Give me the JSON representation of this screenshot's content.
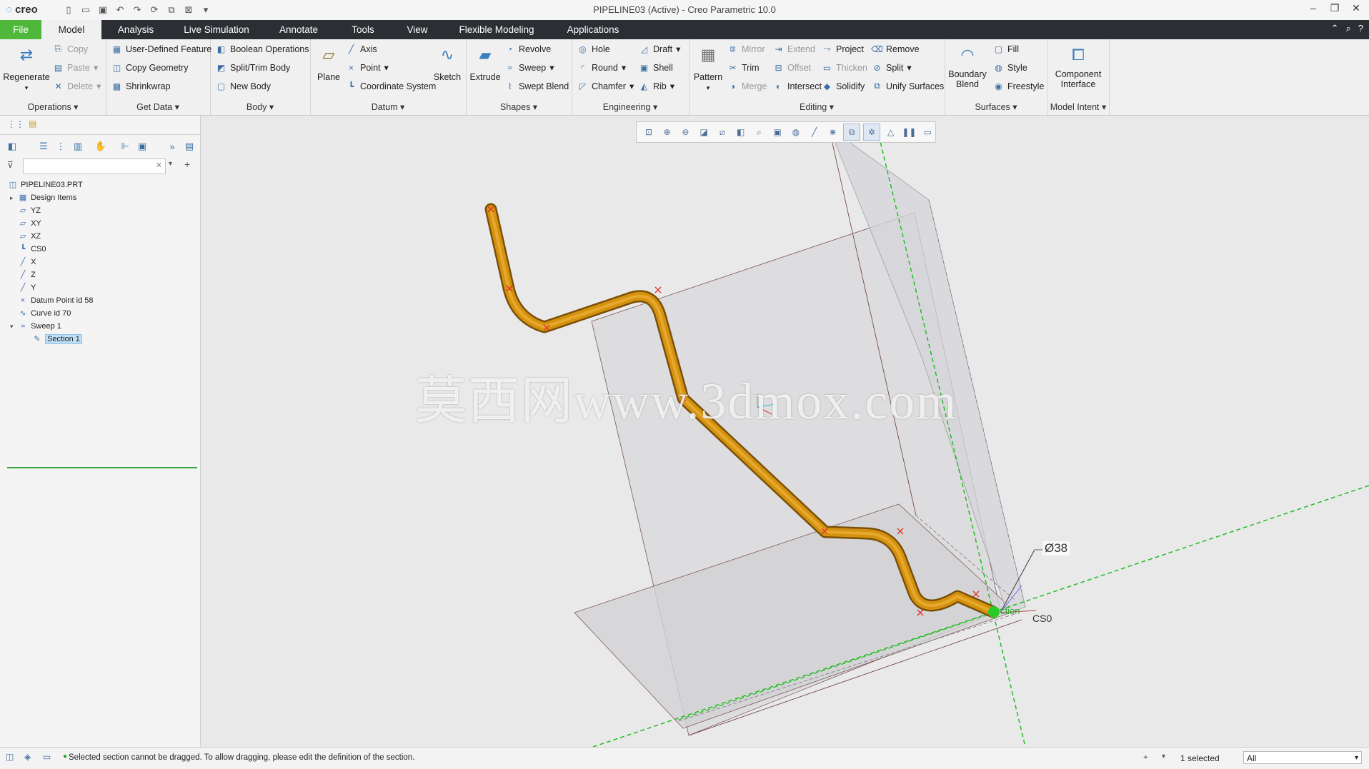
{
  "app": {
    "logo": "creo",
    "window_title": "PIPELINE03 (Active) - Creo Parametric 10.0"
  },
  "tabs": [
    "File",
    "Model",
    "Analysis",
    "Live Simulation",
    "Annotate",
    "Tools",
    "View",
    "Flexible Modeling",
    "Applications"
  ],
  "ribbon": {
    "operations": {
      "label": "Operations",
      "regenerate": "Regenerate",
      "copy": "Copy",
      "paste": "Paste",
      "delete": "Delete"
    },
    "getdata": {
      "label": "Get Data",
      "udf": "User-Defined Feature",
      "copygeom": "Copy Geometry",
      "shrinkwrap": "Shrinkwrap"
    },
    "body": {
      "label": "Body",
      "boolean": "Boolean Operations",
      "split": "Split/Trim Body",
      "newbody": "New Body"
    },
    "datum": {
      "label": "Datum",
      "plane": "Plane",
      "axis": "Axis",
      "point": "Point",
      "csys": "Coordinate System",
      "sketch": "Sketch"
    },
    "shapes": {
      "label": "Shapes",
      "extrude": "Extrude",
      "revolve": "Revolve",
      "sweep": "Sweep",
      "sweptblend": "Swept Blend"
    },
    "engineering": {
      "label": "Engineering",
      "hole": "Hole",
      "round": "Round",
      "chamfer": "Chamfer",
      "draft": "Draft",
      "shell": "Shell",
      "rib": "Rib"
    },
    "editing": {
      "label": "Editing",
      "pattern": "Pattern",
      "mirror": "Mirror",
      "trim": "Trim",
      "merge": "Merge",
      "extend": "Extend",
      "offset": "Offset",
      "intersect": "Intersect",
      "project": "Project",
      "thicken": "Thicken",
      "solidify": "Solidify",
      "remove": "Remove",
      "split": "Split",
      "unify": "Unify Surfaces"
    },
    "surfaces": {
      "label": "Surfaces",
      "boundary": "Boundary Blend",
      "fill": "Fill",
      "style": "Style",
      "freestyle": "Freestyle"
    },
    "modelintent": {
      "label": "Model Intent",
      "component": "Component Interface"
    }
  },
  "tree": {
    "root": "PIPELINE03.PRT",
    "items": [
      "Design Items",
      "YZ",
      "XY",
      "XZ",
      "CS0",
      "X",
      "Z",
      "Y",
      "Datum Point id 58",
      "Curve id 70",
      "Sweep 1",
      "Section 1"
    ]
  },
  "viewport": {
    "watermark": "莫西网www.3dmox.com",
    "dim_label": "Ø38",
    "csys_label": "CS0",
    "section_label": "ction"
  },
  "status": {
    "message": "Selected section cannot be dragged. To allow dragging, please edit the definition of the section.",
    "selected": "1 selected",
    "filter": "All"
  },
  "colors": {
    "file_tab": "#4fb83a",
    "tab_bar": "#2b2f34",
    "pipe": "#c8860e",
    "datum_green": "#22bb22"
  }
}
